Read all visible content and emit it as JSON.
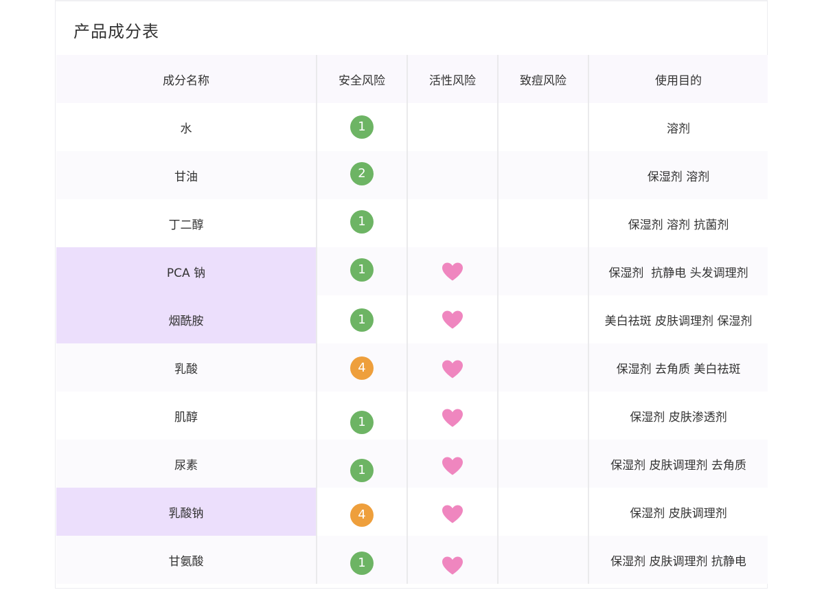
{
  "title": "产品成分表",
  "columns": [
    "成分名称",
    "安全风险",
    "活性风险",
    "致痘风险",
    "使用目的"
  ],
  "colors": {
    "green": "#6db464",
    "orange": "#ee9f3c",
    "heart": "#ef86bf",
    "highlight": "#ecdffc"
  },
  "rows": [
    {
      "name": "水",
      "safety": "1",
      "active": false,
      "acne": false,
      "purpose": "溶剂",
      "highlight": false
    },
    {
      "name": "甘油",
      "safety": "2",
      "active": false,
      "acne": false,
      "purpose": "保湿剂 溶剂",
      "highlight": false
    },
    {
      "name": "丁二醇",
      "safety": "1",
      "active": false,
      "acne": false,
      "purpose": "保湿剂 溶剂 抗菌剂",
      "highlight": false
    },
    {
      "name": "PCA 钠",
      "safety": "1",
      "active": true,
      "acne": false,
      "purpose": "保湿剂  抗静电 头发调理剂",
      "highlight": true
    },
    {
      "name": "烟酰胺",
      "safety": "1",
      "active": true,
      "acne": false,
      "purpose": "美白祛斑 皮肤调理剂 保湿剂",
      "highlight": true
    },
    {
      "name": "乳酸",
      "safety": "4",
      "active": true,
      "acne": false,
      "purpose": "保湿剂 去角质 美白祛斑",
      "highlight": false
    },
    {
      "name": "肌醇",
      "safety": "1",
      "active": true,
      "acne": false,
      "purpose": "保湿剂 皮肤渗透剂",
      "highlight": false
    },
    {
      "name": "尿素",
      "safety": "1",
      "active": true,
      "acne": false,
      "purpose": "保湿剂 皮肤调理剂 去角质",
      "highlight": false
    },
    {
      "name": "乳酸钠",
      "safety": "4",
      "active": true,
      "acne": false,
      "purpose": "保湿剂 皮肤调理剂",
      "highlight": true
    },
    {
      "name": "甘氨酸",
      "safety": "1",
      "active": true,
      "acne": false,
      "purpose": "保湿剂 皮肤调理剂 抗静电",
      "highlight": false
    }
  ]
}
